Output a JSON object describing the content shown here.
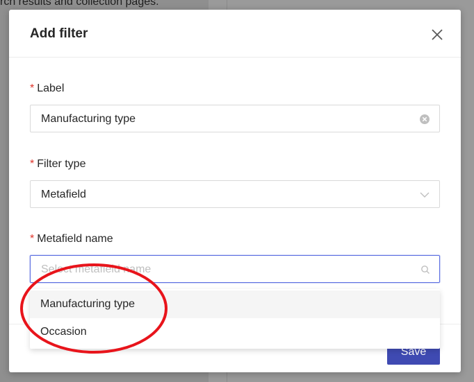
{
  "background": {
    "partial_text": "rch results and collection pages."
  },
  "modal": {
    "title": "Add filter",
    "fields": {
      "label": {
        "required_mark": "*",
        "label": "Label",
        "value": "Manufacturing type"
      },
      "filter_type": {
        "required_mark": "*",
        "label": "Filter type",
        "value": "Metafield"
      },
      "metafield_name": {
        "required_mark": "*",
        "label": "Metafield name",
        "placeholder": "Select metafield name"
      }
    },
    "dropdown_options": [
      "Manufacturing type",
      "Occasion"
    ],
    "footer": {
      "save_label": "Save"
    }
  },
  "colors": {
    "primary_button": "#3f4ab2",
    "required_asterisk": "#e0352b",
    "focus_border": "#5b6ee1",
    "annotation_circle": "#e8141b"
  },
  "icons": {
    "close": "close-icon",
    "clear": "clear-icon",
    "dropdown": "chevron-down-icon",
    "search": "search-icon"
  }
}
